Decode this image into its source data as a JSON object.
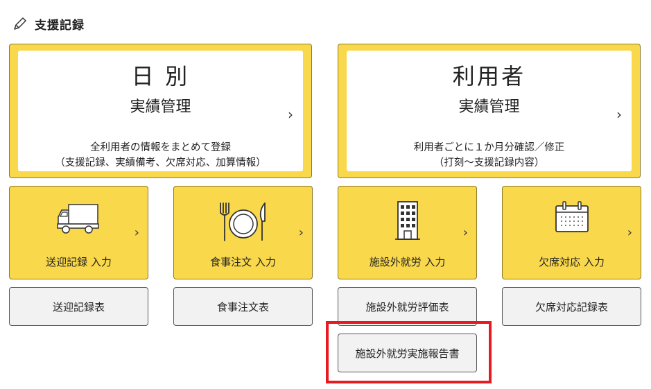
{
  "header": {
    "title": "支援記録",
    "icon": "pencil-icon"
  },
  "cards": {
    "daily": {
      "title": "日 別",
      "subtitle": "実績管理",
      "desc1": "全利用者の情報をまとめて登録",
      "desc2": "（支援記録、実績備考、欠席対応、加算情報）"
    },
    "user": {
      "title": "利用者",
      "subtitle": "実績管理",
      "desc1": "利用者ごとに１か月分確認／修正",
      "desc2": "（打刻〜支援記録内容）"
    }
  },
  "tiles": [
    {
      "label": "送迎記録 入力",
      "icon": "truck-icon"
    },
    {
      "label": "食事注文 入力",
      "icon": "meal-icon"
    },
    {
      "label": "施設外就労 入力",
      "icon": "building-icon"
    },
    {
      "label": "欠席対応 入力",
      "icon": "calendar-icon"
    }
  ],
  "buttons": {
    "row": [
      "送迎記録表",
      "食事注文表",
      "施設外就労評価表",
      "欠席対応記録表"
    ],
    "report": "施設外就労実施報告書"
  },
  "chevron": "›",
  "colors": {
    "accent": "#f9d84c",
    "highlight": "#e8191f",
    "button_bg": "#f2f2f2"
  }
}
